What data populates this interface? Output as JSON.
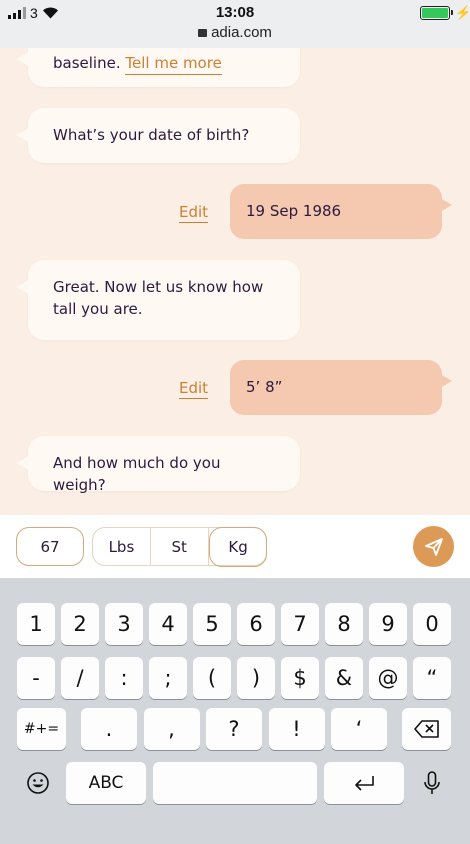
{
  "status_bar": {
    "carrier": "3",
    "time": "13:08",
    "url": "adia.com"
  },
  "chat": {
    "partial_text": "baseline.",
    "partial_link": "Tell me more",
    "q_dob": "What’s your date of birth?",
    "a_dob": "19 Sep 1986",
    "edit_label": "Edit",
    "q_height": "Great. Now let us know how tall you are.",
    "a_height": "5’ 8”",
    "q_weight": "And how much do you weigh?"
  },
  "input": {
    "value": "67",
    "units": [
      "Lbs",
      "St",
      "Kg"
    ],
    "selected_unit": "Kg"
  },
  "keyboard": {
    "row1": [
      "1",
      "2",
      "3",
      "4",
      "5",
      "6",
      "7",
      "8",
      "9",
      "0"
    ],
    "row2": [
      "-",
      "/",
      ":",
      ";",
      "(",
      ")",
      "$",
      "&",
      "@",
      "“"
    ],
    "row3_left": "#+=",
    "row3": [
      ".",
      ",",
      "?",
      "!",
      "‘"
    ],
    "abc": "ABC"
  },
  "colors": {
    "accent": "#d07f32",
    "user_bubble": "#f5c9b0",
    "bot_bubble": "#fff9f3",
    "chat_bg": "#fbeee4",
    "send_button": "#dd9a57"
  }
}
